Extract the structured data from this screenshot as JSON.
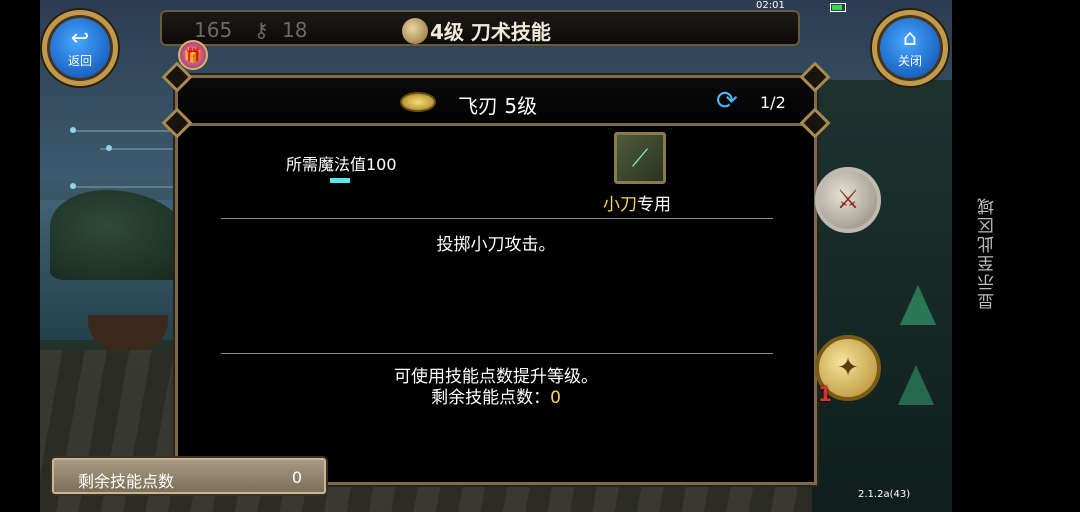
{
  "status_bar": {
    "time": "02:01"
  },
  "top_bar": {
    "stat_a": "165",
    "stat_b": "18",
    "title": "4级 刀术技能"
  },
  "back_button": {
    "label": "返回"
  },
  "close_button": {
    "label": "关闭"
  },
  "dialog": {
    "skill_name": "飞刃 5级",
    "page_indicator": "1/2",
    "mp_requirement": "所需魔法值100",
    "weapon_type_highlight": "小刀",
    "weapon_type_suffix": "专用",
    "description": "投掷小刀攻击。",
    "upgrade_hint": "可使用技能点数提升等级。",
    "remaining_label": "剩余技能点数：",
    "remaining_value": "0"
  },
  "skill_points_panel": {
    "label": "剩余技能点数",
    "value": "0"
  },
  "medal_badge": "1",
  "version": "2.1.2a(43)",
  "side_text": "显示至此区域",
  "colors": {
    "accent_gold": "#f7d84a",
    "mp_bar": "#56e8f0",
    "button_blue": "#1761c0",
    "frame": "#7b6a4c"
  },
  "icons": {
    "back": "return-arrow-icon",
    "close": "home-icon",
    "refresh": "refresh-icon",
    "gift": "gift-icon",
    "skill": "flying-blade-icon",
    "weapon": "knife-icon"
  }
}
